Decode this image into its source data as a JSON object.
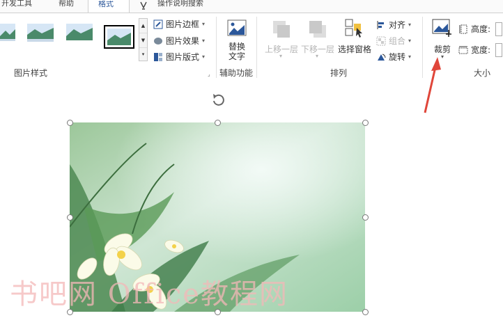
{
  "tabs": [
    {
      "label": "开发工具"
    },
    {
      "label": "帮助"
    },
    {
      "label": "格式"
    },
    {
      "label": "操作说明搜索"
    }
  ],
  "picture_styles": {
    "group_label": "图片样式",
    "border_label": "图片边框",
    "effects_label": "图片效果",
    "layout_label": "图片版式"
  },
  "accessibility": {
    "group_label": "辅助功能",
    "alt_text_line1": "替换",
    "alt_text_line2": "文字"
  },
  "arrange": {
    "group_label": "排列",
    "bring_forward": "上移一层",
    "send_backward": "下移一层",
    "selection_pane": "选择窗格",
    "align": "对齐",
    "group": "组合",
    "rotate": "旋转"
  },
  "size": {
    "group_label": "大小",
    "crop": "裁剪",
    "height_label": "高度:",
    "width_label": "宽度:"
  },
  "watermark": "书吧网 Office教程网",
  "colors": {
    "accent": "#2b579a",
    "arrow": "#e0463a",
    "watermark": "#f4b8b8"
  }
}
